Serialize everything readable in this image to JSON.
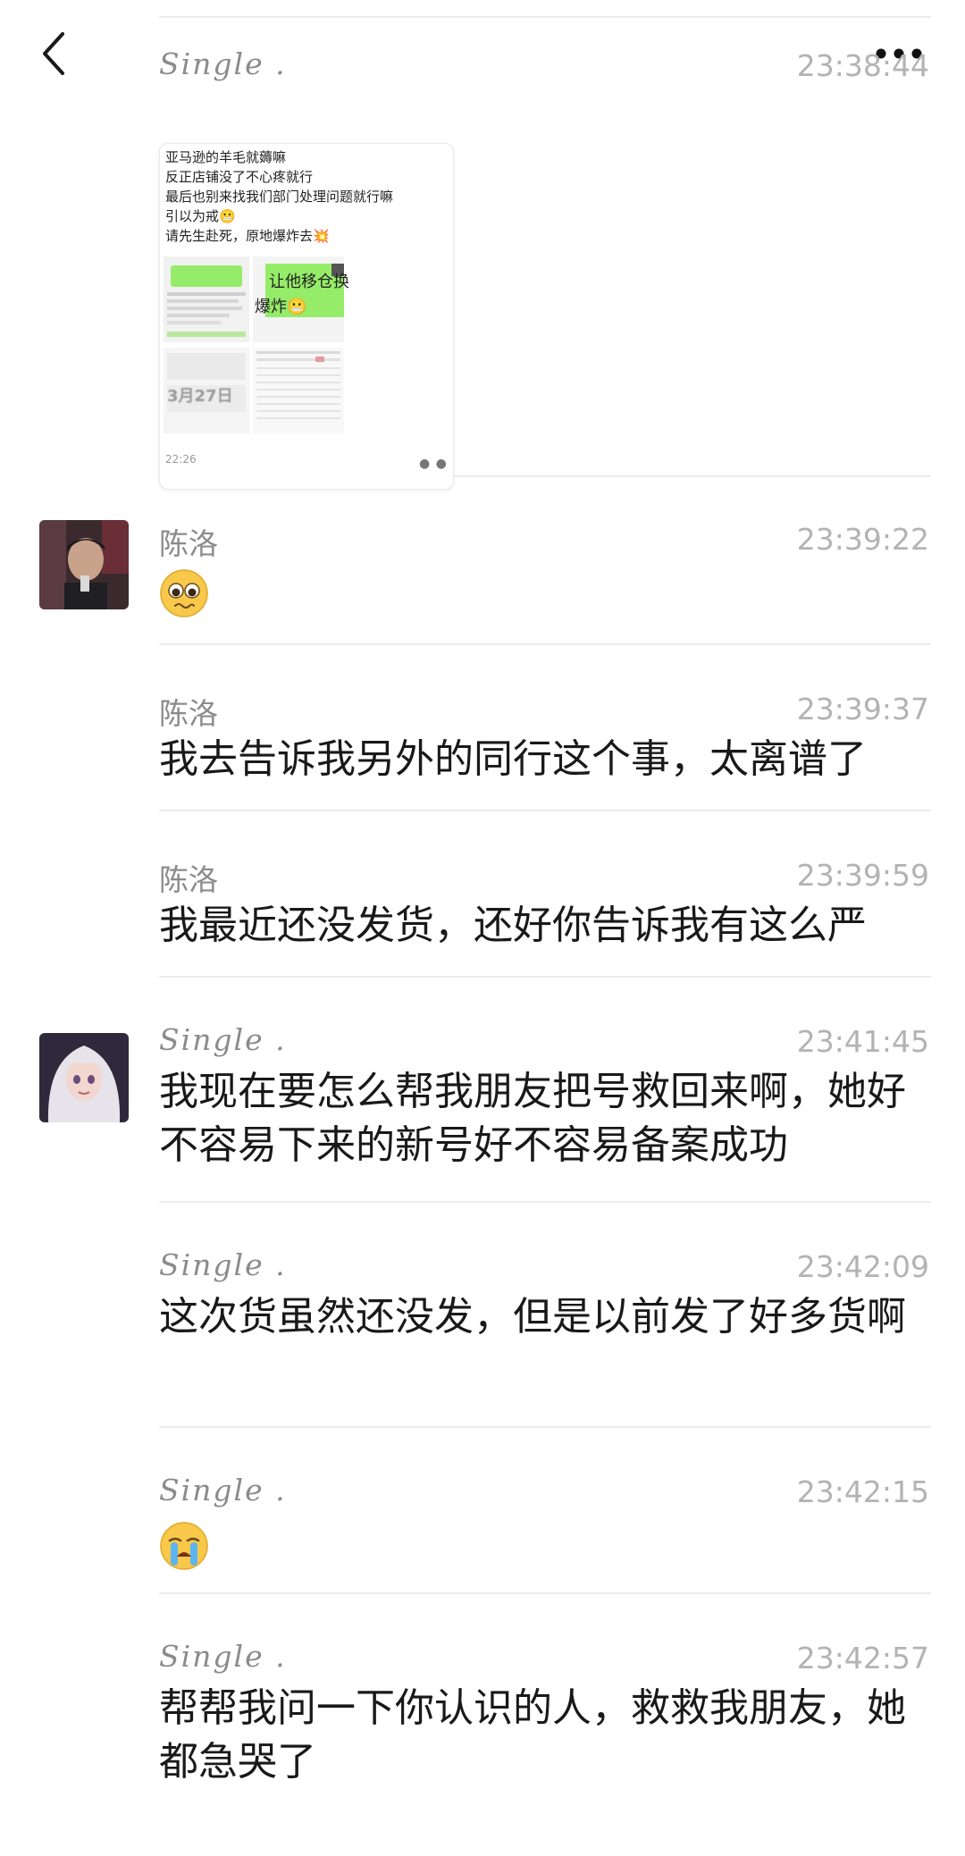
{
  "header": {
    "back_icon": "chevron-left-icon",
    "more_icon": "more-dots-icon"
  },
  "messages": [
    {
      "sender": "Single .",
      "time": "23:38:44",
      "forward_card": {
        "lines": [
          "亚马逊的羊毛就薅嘛",
          "反正店铺没了不心疼就行",
          "最后也别来找我们部门处理问题就行嘛",
          "引以为戒😬",
          "请先生赴死，原地爆炸去💥"
        ],
        "image_text_1": "让他移仓换",
        "image_text_2": "爆炸😬",
        "image_text_3": "3月27日",
        "time": "22:26"
      }
    },
    {
      "sender": "陈洛",
      "time": "23:39:22",
      "emoji": "pleading-face"
    },
    {
      "sender": "陈洛",
      "time": "23:39:37",
      "text": "我去告诉我另外的同行这个事，太离谱了"
    },
    {
      "sender": "陈洛",
      "time": "23:39:59",
      "text": "我最近还没发货，还好你告诉我有这么严"
    },
    {
      "sender": "Single .",
      "time": "23:41:45",
      "text": "我现在要怎么帮我朋友把号救回来啊，她好不容易下来的新号好不容易备案成功"
    },
    {
      "sender": "Single .",
      "time": "23:42:09",
      "text": "这次货虽然还没发，但是以前发了好多货啊"
    },
    {
      "sender": "Single .",
      "time": "23:42:15",
      "emoji": "crying-face"
    },
    {
      "sender": "Single .",
      "time": "23:42:57",
      "text": "帮帮我问一下你认识的人，救救我朋友，她都急哭了"
    }
  ],
  "colors": {
    "sender": "#8b8b8b",
    "time": "#b3b3b3",
    "text": "#191919",
    "divider": "#ececec",
    "green_bubble": "#95ec69"
  }
}
